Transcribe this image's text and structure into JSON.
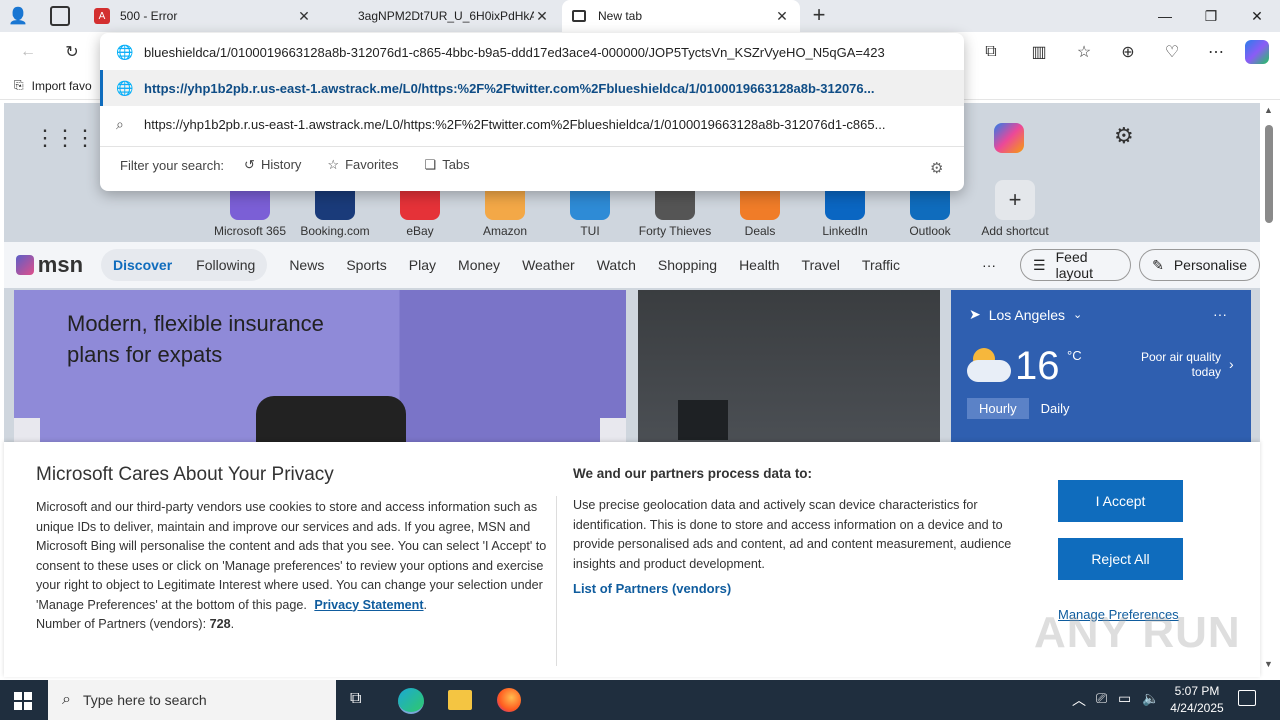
{
  "tabs": [
    {
      "title": "500 - Error",
      "close": "✕"
    },
    {
      "title": "3agNPM2Dt7UR_U_6H0ixPdHkAF",
      "close": "✕"
    },
    {
      "title": "New tab",
      "close": "✕"
    }
  ],
  "new_tab_symbol": "+",
  "window_controls": {
    "minimize": "—",
    "restore": "❐",
    "close": "✕"
  },
  "address_bar": {
    "value": "blueshieldca/1/0100019663128a8b-312076d1-c865-4bbc-b9a5-ddd17ed3ace4-000000/JOP5TyctsVn_KSZrVyeHO_N5qGA=423"
  },
  "omnibox": {
    "suggestions": [
      {
        "text": "https://yhp1b2pb.r.us-east-1.awstrack.me/L0/https:%2F%2Ftwitter.com%2Fblueshieldca/1/0100019663128a8b-312076...",
        "icon": "globe-icon",
        "selected": true
      },
      {
        "text": "https://yhp1b2pb.r.us-east-1.awstrack.me/L0/https:%2F%2Ftwitter.com%2Fblueshieldca/1/0100019663128a8b-312076d1-c865...",
        "icon": "search-icon",
        "selected": false
      }
    ],
    "filter_label": "Filter your search:",
    "filters": [
      "History",
      "Favorites",
      "Tabs"
    ]
  },
  "favorites_bar": {
    "import": "Import favo"
  },
  "shortcuts": [
    {
      "label": "Microsoft 365",
      "color": "#7b5fd6"
    },
    {
      "label": "Booking.com",
      "color": "#1a3b7a"
    },
    {
      "label": "eBay",
      "color": "#e53238"
    },
    {
      "label": "Amazon",
      "color": "#f3a847"
    },
    {
      "label": "TUI",
      "color": "#2e8bd6"
    },
    {
      "label": "Forty Thieves",
      "color": "#555555"
    },
    {
      "label": "Deals",
      "color": "#f07c28"
    },
    {
      "label": "LinkedIn",
      "color": "#0a66c2"
    },
    {
      "label": "Outlook",
      "color": "#0f6cbd"
    },
    {
      "label": "Add shortcut",
      "color": "#e0e0e0"
    }
  ],
  "msn": {
    "logo": "msn",
    "tabs": [
      "Discover",
      "Following"
    ],
    "nav": [
      "News",
      "Sports",
      "Play",
      "Money",
      "Weather",
      "Watch",
      "Shopping",
      "Health",
      "Travel",
      "Traffic"
    ],
    "more": "···",
    "feed_layout": "Feed layout",
    "personalise": "Personalise"
  },
  "ad_card": {
    "headline": "Modern, flexible insurance plans for expats"
  },
  "weather": {
    "location": "Los Angeles",
    "temp": "16",
    "unit": "°C",
    "air_quality": "Poor air quality today",
    "tabs": [
      "Hourly",
      "Daily"
    ],
    "more": "···"
  },
  "privacy": {
    "title": "Microsoft Cares About Your Privacy",
    "body": "Microsoft and our third-party vendors use cookies to store and access information such as unique IDs to deliver, maintain and improve our services and ads. If you agree, MSN and Microsoft Bing will personalise the content and ads that you see. You can select 'I Accept' to consent to these uses or click on 'Manage preferences' to review your options and exercise your right to object to Legitimate Interest where used.  You can change your selection under 'Manage Preferences' at the bottom of this page.",
    "privacy_link": "Privacy Statement",
    "partners_label": "Number of Partners (vendors):",
    "partners_count": "728",
    "process_title": "We and our partners process data to:",
    "process_body": "Use precise geolocation data and actively scan device characteristics for identification. This is done to store and access information on a device and to provide personalised ads and content, ad and content measurement, audience insights and product development.",
    "list_partners": "List of Partners (vendors)",
    "accept": "I Accept",
    "reject": "Reject All",
    "manage": "Manage Preferences"
  },
  "taskbar": {
    "search_placeholder": "Type here to search",
    "time": "5:07 PM",
    "date": "4/24/2025"
  },
  "watermark": "ANY RUN"
}
